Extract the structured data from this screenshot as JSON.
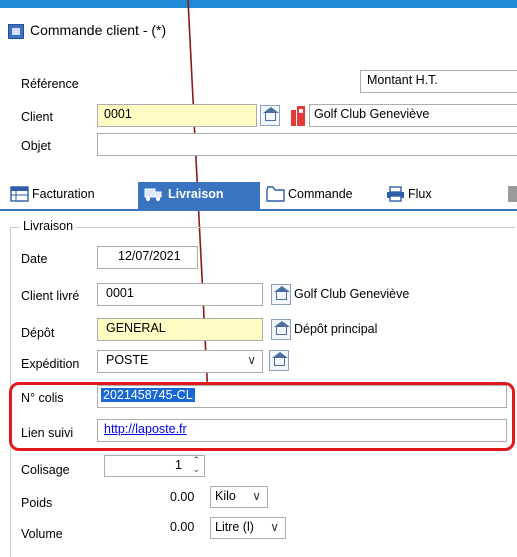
{
  "window": {
    "title": "Commande client -  (*)"
  },
  "header": {
    "reference_label": "Référence",
    "montant_label": "Montant H.T.",
    "client_label": "Client",
    "client_code": "0001",
    "client_name": "Golf Club Geneviève",
    "objet_label": "Objet",
    "objet_value": ""
  },
  "tabs": [
    {
      "label": "Facturation",
      "icon": "table-icon",
      "active": false
    },
    {
      "label": "Livraison",
      "icon": "truck-icon",
      "active": true
    },
    {
      "label": "Commande",
      "icon": "folder-icon",
      "active": false
    },
    {
      "label": "Flux",
      "icon": "printer-icon",
      "active": false
    }
  ],
  "livraison": {
    "group_title": "Livraison",
    "date_label": "Date",
    "date_value": "12/07/2021",
    "client_livre_label": "Client livré",
    "client_livre_code": "0001",
    "client_livre_name": "Golf Club Geneviève",
    "depot_label": "Dépôt",
    "depot_code": "GENERAL",
    "depot_name": "Dépôt principal",
    "expedition_label": "Expédition",
    "expedition_value": "POSTE",
    "colis_label": "N° colis",
    "colis_value": "2021458745-CL",
    "lien_label": "Lien suivi",
    "lien_value": "http://laposte.fr",
    "colisage_label": "Colisage",
    "colisage_value": "1",
    "poids_label": "Poids",
    "poids_value": "0.00",
    "poids_unit": "Kilo",
    "volume_label": "Volume",
    "volume_value": "0.00",
    "volume_unit": "Litre (l)"
  },
  "colors": {
    "accent": "#3a74c1",
    "highlight": "#e0191c",
    "yellow_field": "#fefcc3",
    "arrow": "#8b1a1a"
  }
}
